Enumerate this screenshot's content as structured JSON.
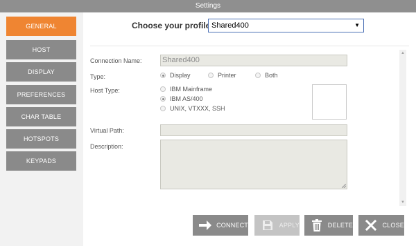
{
  "window": {
    "title": "Settings"
  },
  "sidebar": {
    "items": [
      {
        "label": "GENERAL",
        "active": true
      },
      {
        "label": "HOST",
        "active": false
      },
      {
        "label": "DISPLAY",
        "active": false
      },
      {
        "label": "PREFERENCES",
        "active": false
      },
      {
        "label": "CHAR TABLE",
        "active": false
      },
      {
        "label": "HOTSPOTS",
        "active": false
      },
      {
        "label": "KEYPADS",
        "active": false
      }
    ],
    "accent_color": "#ef8532",
    "item_color": "#8a8a8a"
  },
  "profile": {
    "label": "Choose your profile:",
    "selected": "Shared400",
    "caret": "▼"
  },
  "form": {
    "connection_name": {
      "label": "Connection Name:",
      "value": "Shared400"
    },
    "type": {
      "label": "Type:",
      "options": [
        "Display",
        "Printer",
        "Both"
      ],
      "selected": "Display"
    },
    "host_type": {
      "label": "Host Type:",
      "options": [
        "IBM Mainframe",
        "IBM AS/400",
        "UNIX, VTXXX, SSH"
      ],
      "selected": "IBM AS/400"
    },
    "virtual_path": {
      "label": "Virtual Path:",
      "value": ""
    },
    "description": {
      "label": "Description:",
      "value": ""
    }
  },
  "buttons": {
    "connect": {
      "label": "CONNECT",
      "icon": "arrow-right-icon"
    },
    "apply": {
      "label": "APPLY",
      "icon": "floppy-disk-icon",
      "disabled": true
    },
    "delete": {
      "label": "DELETE",
      "icon": "trash-icon"
    },
    "close": {
      "label": "CLOSE",
      "icon": "close-x-icon"
    }
  }
}
